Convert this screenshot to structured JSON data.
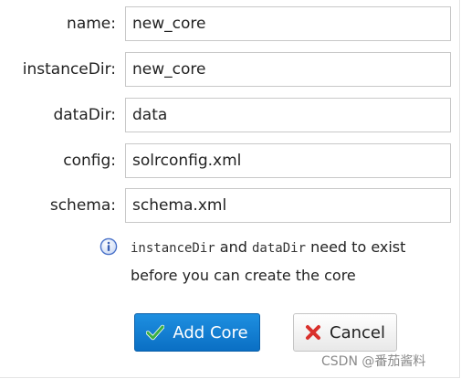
{
  "form": {
    "fields": [
      {
        "label": "name:",
        "value": "new_core"
      },
      {
        "label": "instanceDir:",
        "value": "new_core"
      },
      {
        "label": "dataDir:",
        "value": "data"
      },
      {
        "label": "config:",
        "value": "solrconfig.xml"
      },
      {
        "label": "schema:",
        "value": "schema.xml"
      }
    ]
  },
  "info": {
    "code1": "instanceDir",
    "and": " and ",
    "code2": "dataDir",
    "text_line1_end": " need to exist",
    "text_line2": "before you can create the core"
  },
  "buttons": {
    "add_label": "Add Core",
    "cancel_label": "Cancel"
  },
  "watermark": "CSDN @番茄酱料",
  "colors": {
    "primary": "#0a6fc4",
    "check": "#3cb043",
    "cancel_x": "#d9302c",
    "info_icon": "#4a72c9"
  },
  "icons": {
    "info": "info-icon",
    "add": "check-icon",
    "cancel": "close-icon"
  }
}
